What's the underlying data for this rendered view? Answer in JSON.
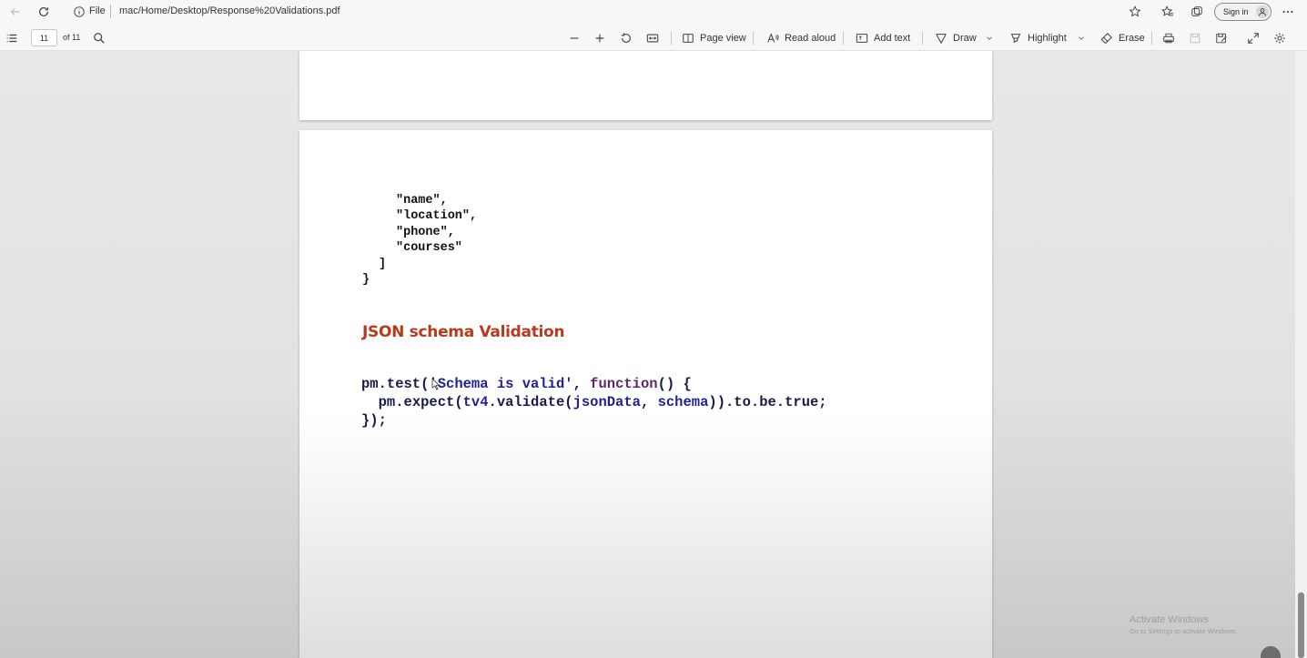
{
  "browser": {
    "file_label": "File",
    "url": "mac/Home/Desktop/Response%20Validations.pdf",
    "signin_label": "Sign in",
    "icons": [
      "back-arrow-icon",
      "refresh-icon",
      "info-icon",
      "favorites-add-icon",
      "favorites-icon",
      "collections-icon",
      "user-icon",
      "more-icon"
    ]
  },
  "pdf_toolbar": {
    "page_current": "11",
    "page_total": "of 11",
    "page_view_label": "Page view",
    "read_aloud_label": "Read aloud",
    "add_text_label": "Add text",
    "draw_label": "Draw",
    "highlight_label": "Highlight",
    "erase_label": "Erase"
  },
  "document": {
    "json_lines": [
      "\"name\",",
      "\"location\",",
      "\"phone\",",
      "\"courses\"",
      "]",
      "}"
    ],
    "section_heading": "JSON schema Validation",
    "code": {
      "l1_a": "pm.test(",
      "l1_b": "'Schema is valid'",
      "l1_c": ", ",
      "l1_d": "function",
      "l1_e": "() {",
      "l2_a": "pm.expect(",
      "l2_b": "tv4",
      "l2_c": ".validate(",
      "l2_d": "jsonData",
      "l2_e": ", ",
      "l2_f": "schema",
      "l2_g": ")).to.be.true;",
      "l3": "});"
    }
  },
  "watermark": {
    "title": "Activate Windows",
    "subtitle": "Go to Settings to activate Windows."
  }
}
